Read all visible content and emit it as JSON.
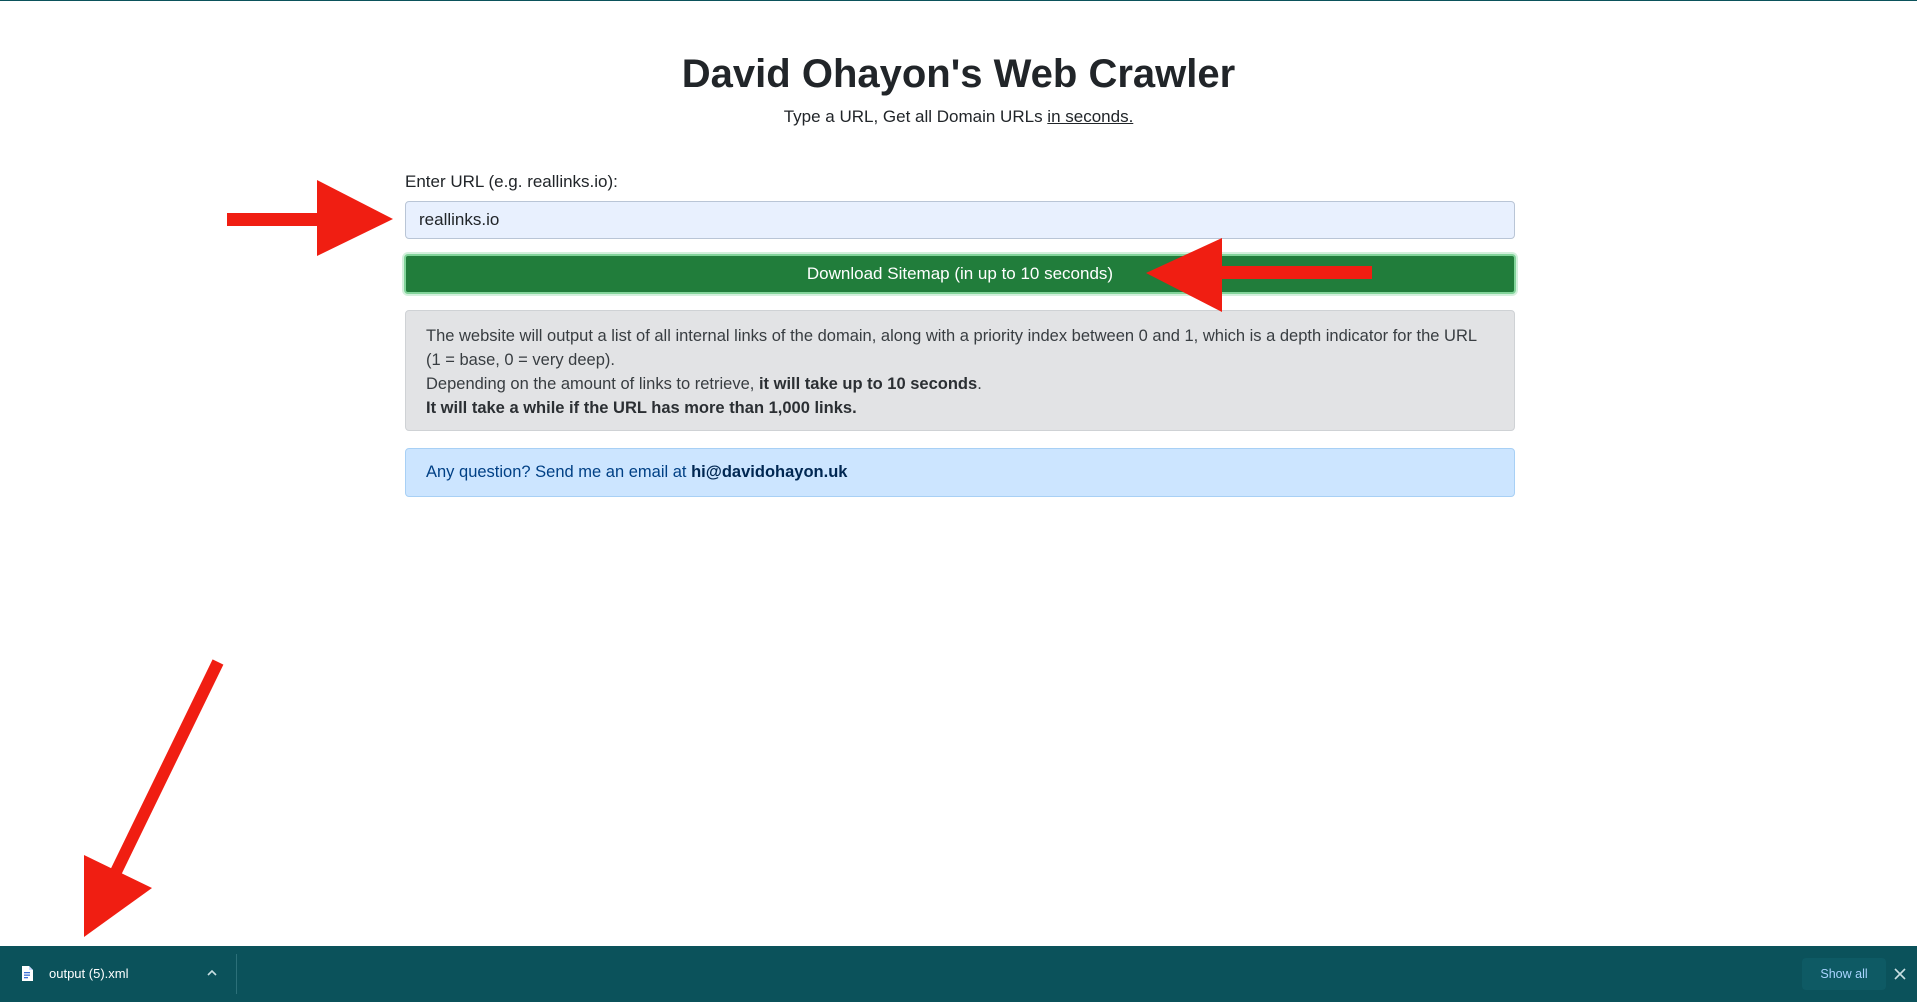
{
  "page": {
    "title": "David Ohayon's Web Crawler",
    "subtitle_prefix": "Type a URL, Get all Domain URLs ",
    "subtitle_underlined": "in seconds."
  },
  "form": {
    "url_label": "Enter URL (e.g. reallinks.io):",
    "url_value": "reallinks.io",
    "download_button_label": "Download Sitemap (in up to 10 seconds)"
  },
  "info": {
    "line1": "The website will output a list of all internal links of the domain, along with a priority index between 0 and 1, which is a depth indicator for the URL (1 = base, 0 = very deep).",
    "line2_prefix": "Depending on the amount of links to retrieve, ",
    "line2_bold": "it will take up to 10 seconds",
    "line2_suffix": ".",
    "line3_bold": "It will take a while if the URL has more than 1,000 links."
  },
  "contact": {
    "prefix": "Any question? Send me an email at ",
    "email": "hi@davidohayon.uk"
  },
  "download_bar": {
    "file_name": "output (5).xml",
    "file_icon": "document-icon",
    "chevron_icon": "chevron-up-icon",
    "show_all_label": "Show all",
    "close_icon": "close-icon"
  },
  "colors": {
    "button_green": "#217d3b",
    "download_bar": "#0b525b",
    "annotation_arrow": "#f01e12",
    "info_bg": "#e2e3e5",
    "contact_bg": "#cce5ff"
  }
}
